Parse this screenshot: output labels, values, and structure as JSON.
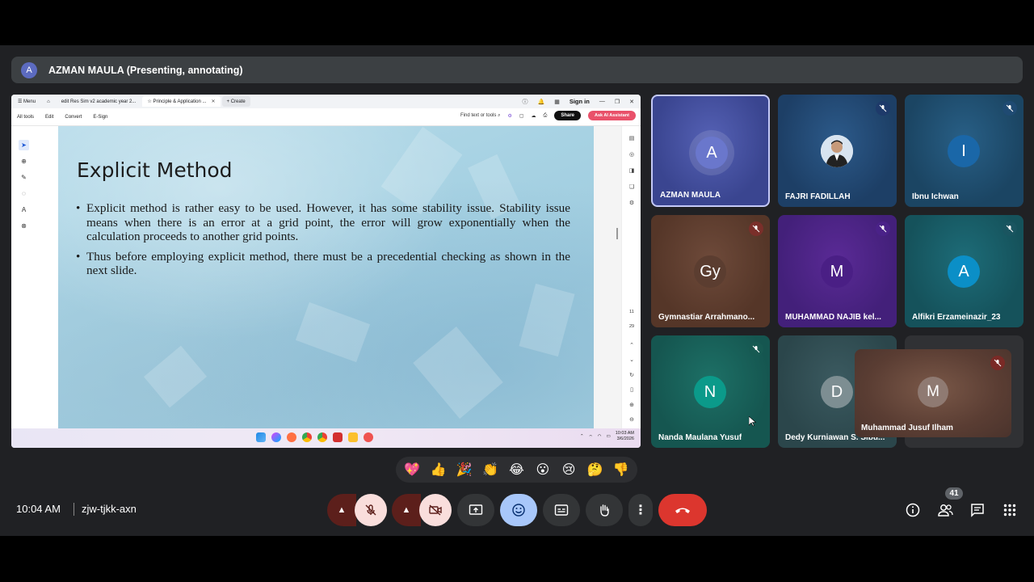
{
  "presenter": {
    "avatar_letter": "A",
    "label": "AZMAN MAULA (Presenting, annotating)"
  },
  "browser": {
    "tabs": [
      {
        "label": "Menu"
      },
      {
        "label": "edit Res Sim  v2 academic year 2..."
      },
      {
        "label": "Principle & Application ..."
      },
      {
        "label": "+ Create"
      }
    ],
    "sign_in": "Sign in"
  },
  "pdf_toolbar": {
    "menu": [
      "All tools",
      "Edit",
      "Convert",
      "E-Sign"
    ],
    "find": "Find text or tools",
    "share": "Share",
    "ai": "Ask AI Assistant"
  },
  "page_numbers": {
    "current": "11",
    "total": "29"
  },
  "slide": {
    "title": "Explicit Method",
    "bullets": [
      "Explicit method is rather easy to be used. However, it has some stability issue. Stability issue means when there is an error at a grid point, the error will grow exponentially when the calculation proceeds to another grid points.",
      "Thus before employing explicit method, there must be a precedential checking as shown in the next slide."
    ]
  },
  "os_clock": {
    "time": "10:03 AM",
    "date": "3/6/2026"
  },
  "participants": [
    {
      "name": "AZMAN MAULA",
      "initial": "A"
    },
    {
      "name": "FAJRI FADILLAH",
      "initial": ""
    },
    {
      "name": "Ibnu Ichwan",
      "initial": "I"
    },
    {
      "name": "Gymnastiar Arrahmano...",
      "initial": "Gy"
    },
    {
      "name": "MUHAMMAD NAJIB kel...",
      "initial": "M"
    },
    {
      "name": "Alfikri Erzameinazir_23",
      "initial": "A"
    },
    {
      "name": "Nanda Maulana Yusuf",
      "initial": "N"
    },
    {
      "name": "Dedy Kurniawan S. Sibu...",
      "initial": "D"
    },
    {
      "name": "Muhammad Jusuf Ilham",
      "initial": "M"
    }
  ],
  "reactions": [
    "💖",
    "👍",
    "🎉",
    "👏",
    "😂",
    "😮",
    "😢",
    "🤔",
    "👎"
  ],
  "meeting": {
    "time": "10:04 AM",
    "code": "zjw-tjkk-axn",
    "participant_count": "41"
  },
  "colors": {
    "end_call": "#dc362e",
    "mic_off_bg": "#f9dedc",
    "selected_border": "#c4c9f7",
    "reaction_active": "#a8c7fa"
  }
}
